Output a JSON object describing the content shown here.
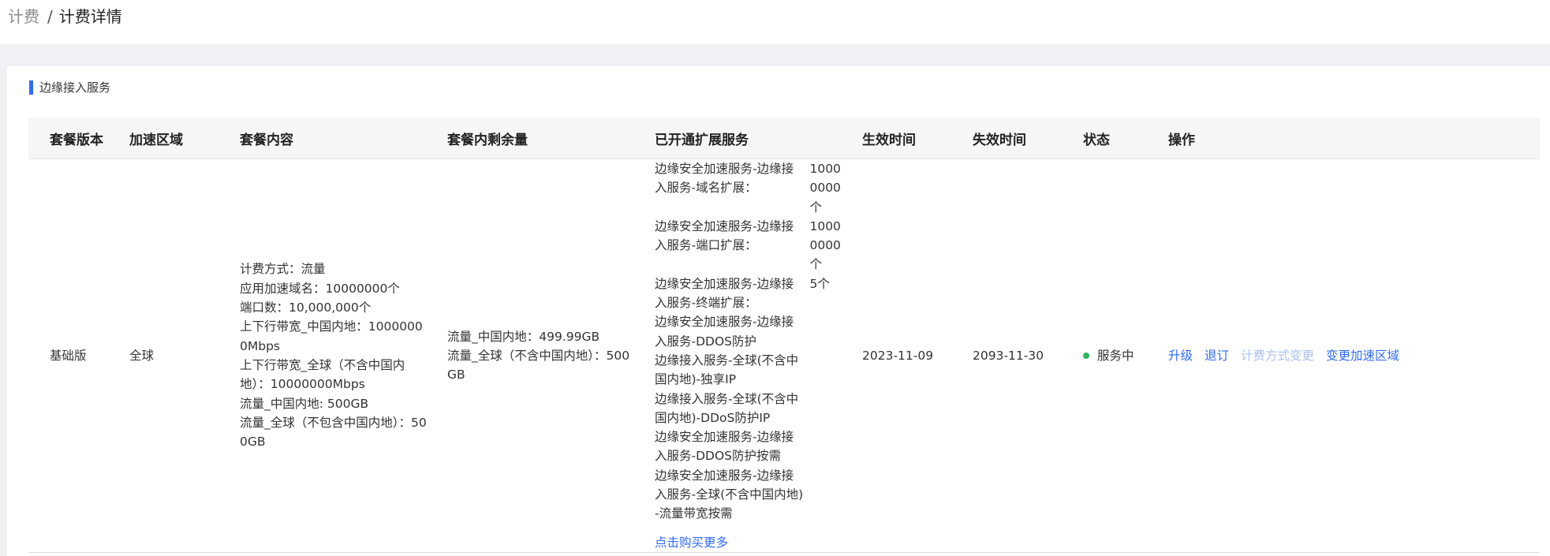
{
  "breadcrumb": {
    "root": "计费",
    "separator": "/",
    "current": "计费详情"
  },
  "section": {
    "title": "边缘接入服务"
  },
  "table": {
    "headers": [
      "套餐版本",
      "加速区域",
      "套餐内容",
      "套餐内剩余量",
      "已开通扩展服务",
      "生效时间",
      "失效时间",
      "状态",
      "操作"
    ],
    "row": {
      "version": "基础版",
      "region": "全球",
      "content": [
        "计费方式：流量",
        "应用加速域名：10000000个",
        "端口数：10,000,000个",
        "上下行带宽_中国内地：10000000Mbps",
        "上下行带宽_全球（不含中国内地）：10000000Mbps",
        "流量_中国内地: 500GB",
        "流量_全球（不包含中国内地）：500GB"
      ],
      "remaining": [
        "流量_中国内地：499.99GB",
        "流量_全球（不含中国内地）：500GB"
      ],
      "extensions": [
        {
          "name": "边缘安全加速服务-边缘接入服务-域名扩展：",
          "qty": "10000000个"
        },
        {
          "name": "边缘安全加速服务-边缘接入服务-端口扩展：",
          "qty": "10000000个"
        },
        {
          "name": "边缘安全加速服务-边缘接入服务-终端扩展：",
          "qty": "5个"
        },
        {
          "name": "边缘安全加速服务-边缘接入服务-DDOS防护",
          "qty": ""
        },
        {
          "name": "边缘接入服务-全球(不含中国内地)-独享IP",
          "qty": ""
        },
        {
          "name": "边缘接入服务-全球(不含中国内地)-DDoS防护IP",
          "qty": ""
        },
        {
          "name": "边缘安全加速服务-边缘接入服务-DDOS防护按需",
          "qty": ""
        },
        {
          "name": "边缘安全加速服务-边缘接入服务-全球(不含中国内地)-流量带宽按需",
          "qty": ""
        }
      ],
      "buy_more": "点击购买更多",
      "start_date": "2023-11-09",
      "end_date": "2093-11-30",
      "status": "服务中",
      "status_color": "#2fb55e",
      "actions": {
        "upgrade": "升级",
        "unsubscribe": "退订",
        "change_billing": "计费方式变更",
        "change_region": "变更加速区域"
      }
    }
  },
  "colors": {
    "accent": "#2f6bff",
    "disabled_link": "#a9c1f5"
  }
}
